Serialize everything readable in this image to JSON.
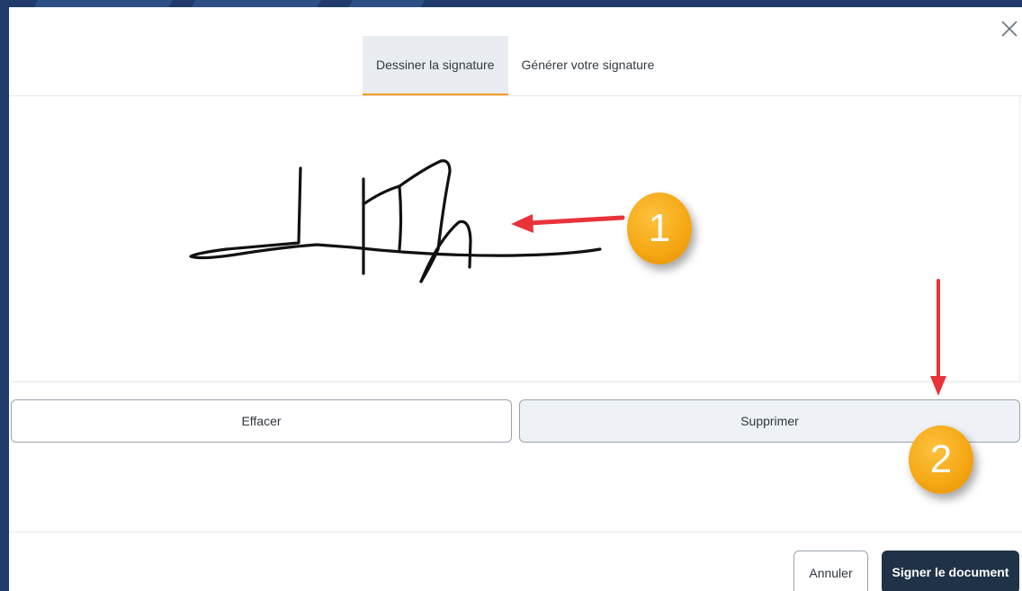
{
  "dialog": {
    "tabs": [
      {
        "label": "Dessiner la signature",
        "active": true
      },
      {
        "label": "Générer votre signature",
        "active": false
      }
    ],
    "close_icon": "close-icon",
    "clear_label": "Effacer",
    "delete_label": "Supprimer",
    "cancel_label": "Annuler",
    "sign_label": "Signer le document"
  },
  "annotations": {
    "marker_1": "1",
    "marker_2": "2"
  },
  "colors": {
    "accent_tab_underline": "#f39a1f",
    "primary_button": "#1f3247",
    "annotation_arrow": "#e8333a",
    "annotation_marker": "#f5a612"
  }
}
